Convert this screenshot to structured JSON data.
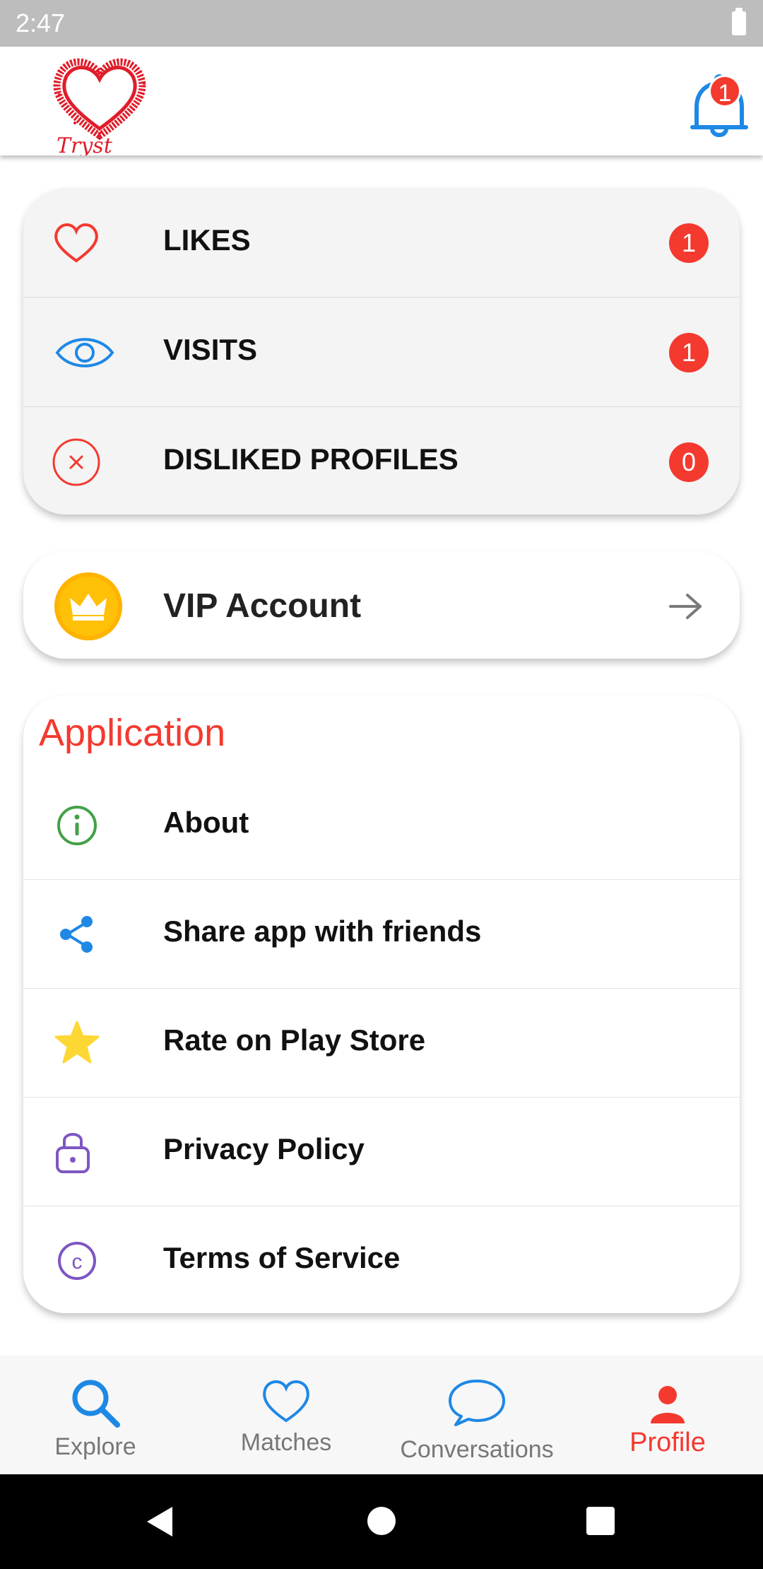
{
  "status_bar": {
    "time": "2:47"
  },
  "header": {
    "notification_count": "1",
    "logo_text": "Tryst"
  },
  "stats": [
    {
      "label": "LIKES",
      "count": "1",
      "icon": "heart-outline-icon"
    },
    {
      "label": "VISITS",
      "count": "1",
      "icon": "eye-icon"
    },
    {
      "label": "DISLIKED PROFILES",
      "count": "0",
      "icon": "x-circle-icon"
    }
  ],
  "vip": {
    "label": "VIP Account",
    "icon": "crown-icon"
  },
  "application": {
    "title": "Application",
    "items": [
      {
        "label": "About",
        "icon": "info-icon"
      },
      {
        "label": "Share app with friends",
        "icon": "share-icon"
      },
      {
        "label": "Rate on Play Store",
        "icon": "star-icon"
      },
      {
        "label": "Privacy Policy",
        "icon": "lock-icon"
      },
      {
        "label": "Terms of Service",
        "icon": "copyright-icon"
      }
    ]
  },
  "bottom_nav": {
    "items": [
      {
        "label": "Explore",
        "icon": "search-icon"
      },
      {
        "label": "Matches",
        "icon": "heart-icon"
      },
      {
        "label": "Conversations",
        "icon": "chat-icon"
      },
      {
        "label": "Profile",
        "icon": "person-icon",
        "active": true
      }
    ]
  },
  "colors": {
    "accent": "#f4392f",
    "blue": "#1e88e5",
    "gold": "#ffc107",
    "green": "#43a047",
    "purple": "#7e57c2",
    "star": "#fdd835"
  }
}
